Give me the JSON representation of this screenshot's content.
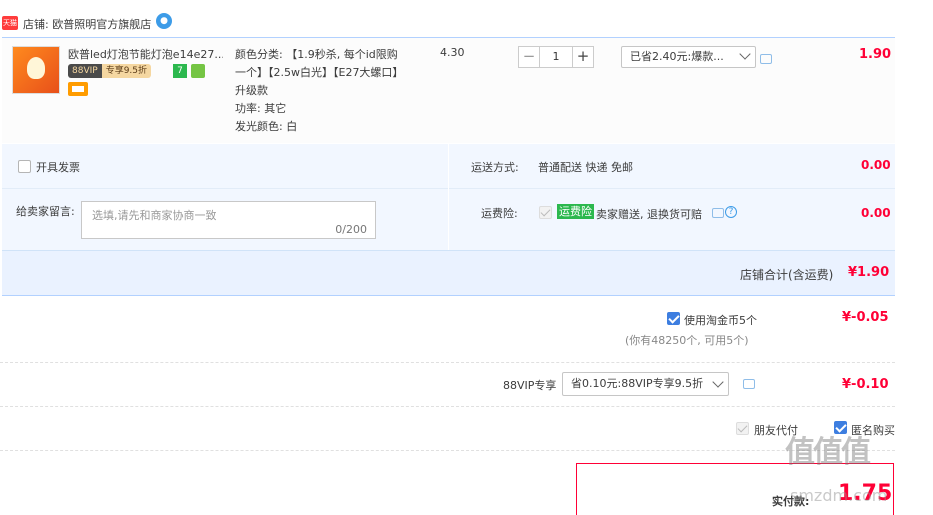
{
  "shop": {
    "badge": "天猫",
    "label": "店铺: 欧普照明官方旗舰店"
  },
  "item": {
    "title": "欧普led灯泡节能灯泡e14e27...",
    "vip_tag_a": "88VIP",
    "vip_tag_b": "专享9.5折",
    "seven_badge": "7",
    "attr_color": "颜色分类: 【1.9秒杀, 每个id限购一个】【2.5w白光】【E27大螺口】升级款",
    "attr_power": "功率: 其它",
    "attr_light": "发光颜色: 白",
    "unit_price": "4.30",
    "qty_minus": "−",
    "qty_value": "1",
    "qty_plus": "+",
    "promo_selected": "已省2.40元:爆款...",
    "total": "1.90"
  },
  "invoice": {
    "label": "开具发票"
  },
  "shipping": {
    "label": "运送方式:",
    "value": "普通配送 快递 免邮",
    "price": "0.00"
  },
  "memo": {
    "label": "给卖家留言:",
    "placeholder": "选填,请先和商家协商一致",
    "count": "0/200"
  },
  "insurance": {
    "label": "运费险:",
    "badge": "运费险",
    "text": "卖家赠送, 退换货可赔",
    "help": "?",
    "price": "0.00"
  },
  "shop_total": {
    "label": "店铺合计(含运费)",
    "value": "¥1.90"
  },
  "coins": {
    "label": "使用淘金币5个",
    "note": "(你有48250个, 可用5个)",
    "value": "¥-0.05"
  },
  "vip": {
    "label": "88VIP专享",
    "selected": "省0.10元:88VIP专享9.5折",
    "value": "¥-0.10"
  },
  "options": {
    "friend_pay": "朋友代付",
    "anonymous": "匿名购买"
  },
  "payment": {
    "label": "实付款:",
    "value": "1.75"
  },
  "watermark": {
    "main": "值值值",
    "sub": "smzdm.com"
  },
  "colors": {
    "accent_red": "#ff0036",
    "accent_blue": "#3d7ee0",
    "panel_blue": "#f2f7ff"
  }
}
